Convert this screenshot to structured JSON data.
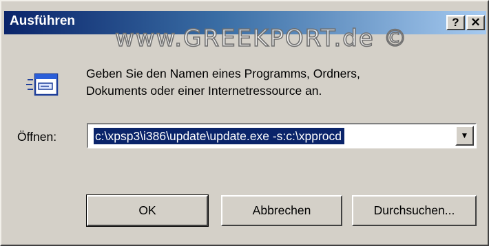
{
  "window": {
    "title": "Ausführen",
    "watermark": "www.GREEKPORT.de ©",
    "help_label": "?",
    "close_label": "✕"
  },
  "description": {
    "line1": "Geben Sie den Namen eines Programms, Ordners,",
    "line2": "Dokuments oder einer Internetressource an."
  },
  "open_field": {
    "label": "Öffnen:",
    "value": "c:\\xpsp3\\i386\\update\\update.exe -s:c:\\xpprocd"
  },
  "buttons": {
    "ok": "OK",
    "cancel": "Abbrechen",
    "browse": "Durchsuchen..."
  },
  "icons": {
    "run": "run-program-icon",
    "dropdown": "dropdown-arrow-icon"
  },
  "colors": {
    "titlebar_start": "#0a246a",
    "titlebar_end": "#a6caf0",
    "dialog_face": "#d4d0c8",
    "selection": "#0a246a"
  }
}
